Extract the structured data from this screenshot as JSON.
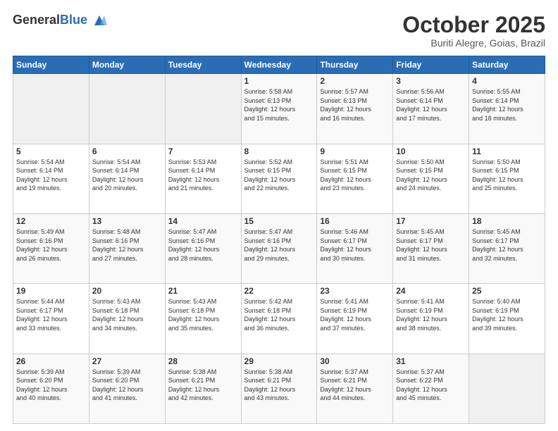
{
  "header": {
    "logo_general": "General",
    "logo_blue": "Blue",
    "title": "October 2025",
    "subtitle": "Buriti Alegre, Goias, Brazil"
  },
  "weekdays": [
    "Sunday",
    "Monday",
    "Tuesday",
    "Wednesday",
    "Thursday",
    "Friday",
    "Saturday"
  ],
  "weeks": [
    [
      {
        "day": "",
        "info": ""
      },
      {
        "day": "",
        "info": ""
      },
      {
        "day": "",
        "info": ""
      },
      {
        "day": "1",
        "info": "Sunrise: 5:58 AM\nSunset: 6:13 PM\nDaylight: 12 hours\nand 15 minutes."
      },
      {
        "day": "2",
        "info": "Sunrise: 5:57 AM\nSunset: 6:13 PM\nDaylight: 12 hours\nand 16 minutes."
      },
      {
        "day": "3",
        "info": "Sunrise: 5:56 AM\nSunset: 6:14 PM\nDaylight: 12 hours\nand 17 minutes."
      },
      {
        "day": "4",
        "info": "Sunrise: 5:55 AM\nSunset: 6:14 PM\nDaylight: 12 hours\nand 18 minutes."
      }
    ],
    [
      {
        "day": "5",
        "info": "Sunrise: 5:54 AM\nSunset: 6:14 PM\nDaylight: 12 hours\nand 19 minutes."
      },
      {
        "day": "6",
        "info": "Sunrise: 5:54 AM\nSunset: 6:14 PM\nDaylight: 12 hours\nand 20 minutes."
      },
      {
        "day": "7",
        "info": "Sunrise: 5:53 AM\nSunset: 6:14 PM\nDaylight: 12 hours\nand 21 minutes."
      },
      {
        "day": "8",
        "info": "Sunrise: 5:52 AM\nSunset: 6:15 PM\nDaylight: 12 hours\nand 22 minutes."
      },
      {
        "day": "9",
        "info": "Sunrise: 5:51 AM\nSunset: 6:15 PM\nDaylight: 12 hours\nand 23 minutes."
      },
      {
        "day": "10",
        "info": "Sunrise: 5:50 AM\nSunset: 6:15 PM\nDaylight: 12 hours\nand 24 minutes."
      },
      {
        "day": "11",
        "info": "Sunrise: 5:50 AM\nSunset: 6:15 PM\nDaylight: 12 hours\nand 25 minutes."
      }
    ],
    [
      {
        "day": "12",
        "info": "Sunrise: 5:49 AM\nSunset: 6:16 PM\nDaylight: 12 hours\nand 26 minutes."
      },
      {
        "day": "13",
        "info": "Sunrise: 5:48 AM\nSunset: 6:16 PM\nDaylight: 12 hours\nand 27 minutes."
      },
      {
        "day": "14",
        "info": "Sunrise: 5:47 AM\nSunset: 6:16 PM\nDaylight: 12 hours\nand 28 minutes."
      },
      {
        "day": "15",
        "info": "Sunrise: 5:47 AM\nSunset: 6:16 PM\nDaylight: 12 hours\nand 29 minutes."
      },
      {
        "day": "16",
        "info": "Sunrise: 5:46 AM\nSunset: 6:17 PM\nDaylight: 12 hours\nand 30 minutes."
      },
      {
        "day": "17",
        "info": "Sunrise: 5:45 AM\nSunset: 6:17 PM\nDaylight: 12 hours\nand 31 minutes."
      },
      {
        "day": "18",
        "info": "Sunrise: 5:45 AM\nSunset: 6:17 PM\nDaylight: 12 hours\nand 32 minutes."
      }
    ],
    [
      {
        "day": "19",
        "info": "Sunrise: 5:44 AM\nSunset: 6:17 PM\nDaylight: 12 hours\nand 33 minutes."
      },
      {
        "day": "20",
        "info": "Sunrise: 5:43 AM\nSunset: 6:18 PM\nDaylight: 12 hours\nand 34 minutes."
      },
      {
        "day": "21",
        "info": "Sunrise: 5:43 AM\nSunset: 6:18 PM\nDaylight: 12 hours\nand 35 minutes."
      },
      {
        "day": "22",
        "info": "Sunrise: 5:42 AM\nSunset: 6:18 PM\nDaylight: 12 hours\nand 36 minutes."
      },
      {
        "day": "23",
        "info": "Sunrise: 5:41 AM\nSunset: 6:19 PM\nDaylight: 12 hours\nand 37 minutes."
      },
      {
        "day": "24",
        "info": "Sunrise: 5:41 AM\nSunset: 6:19 PM\nDaylight: 12 hours\nand 38 minutes."
      },
      {
        "day": "25",
        "info": "Sunrise: 5:40 AM\nSunset: 6:19 PM\nDaylight: 12 hours\nand 39 minutes."
      }
    ],
    [
      {
        "day": "26",
        "info": "Sunrise: 5:39 AM\nSunset: 6:20 PM\nDaylight: 12 hours\nand 40 minutes."
      },
      {
        "day": "27",
        "info": "Sunrise: 5:39 AM\nSunset: 6:20 PM\nDaylight: 12 hours\nand 41 minutes."
      },
      {
        "day": "28",
        "info": "Sunrise: 5:38 AM\nSunset: 6:21 PM\nDaylight: 12 hours\nand 42 minutes."
      },
      {
        "day": "29",
        "info": "Sunrise: 5:38 AM\nSunset: 6:21 PM\nDaylight: 12 hours\nand 43 minutes."
      },
      {
        "day": "30",
        "info": "Sunrise: 5:37 AM\nSunset: 6:21 PM\nDaylight: 12 hours\nand 44 minutes."
      },
      {
        "day": "31",
        "info": "Sunrise: 5:37 AM\nSunset: 6:22 PM\nDaylight: 12 hours\nand 45 minutes."
      },
      {
        "day": "",
        "info": ""
      }
    ]
  ]
}
